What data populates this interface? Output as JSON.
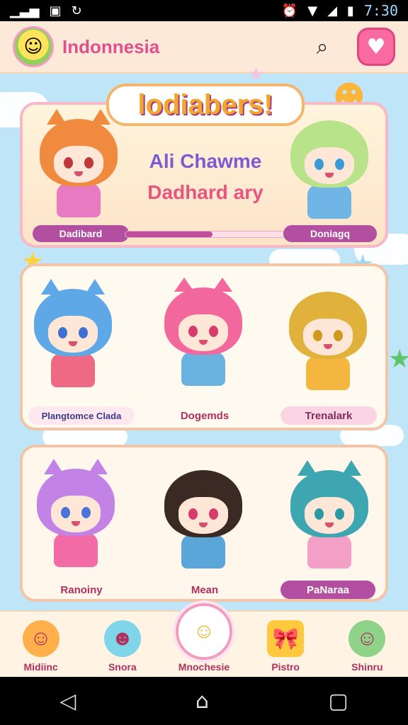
{
  "status_bar": {
    "time": "7:30"
  },
  "header": {
    "title": "Indonnesia"
  },
  "banner": {
    "title": "lodiabers!",
    "line1": "Ali Chawme",
    "line2": "Dadhard ary",
    "left_pill": "Dadibard",
    "right_pill": "Doniagq",
    "progress": 0.55
  },
  "row1": {
    "labels": [
      "Plangtomce Clada",
      "Dogemds",
      "Trenalark"
    ]
  },
  "row2": {
    "labels": [
      "Ranoiny",
      "Mean",
      "PaNaraa"
    ]
  },
  "nav": {
    "items": [
      "Midiinc",
      "Snora",
      "Mnochesie",
      "Pistro",
      "Shinru"
    ]
  },
  "colors": {
    "accent": "#e0508f",
    "pill": "#b24fa0"
  }
}
